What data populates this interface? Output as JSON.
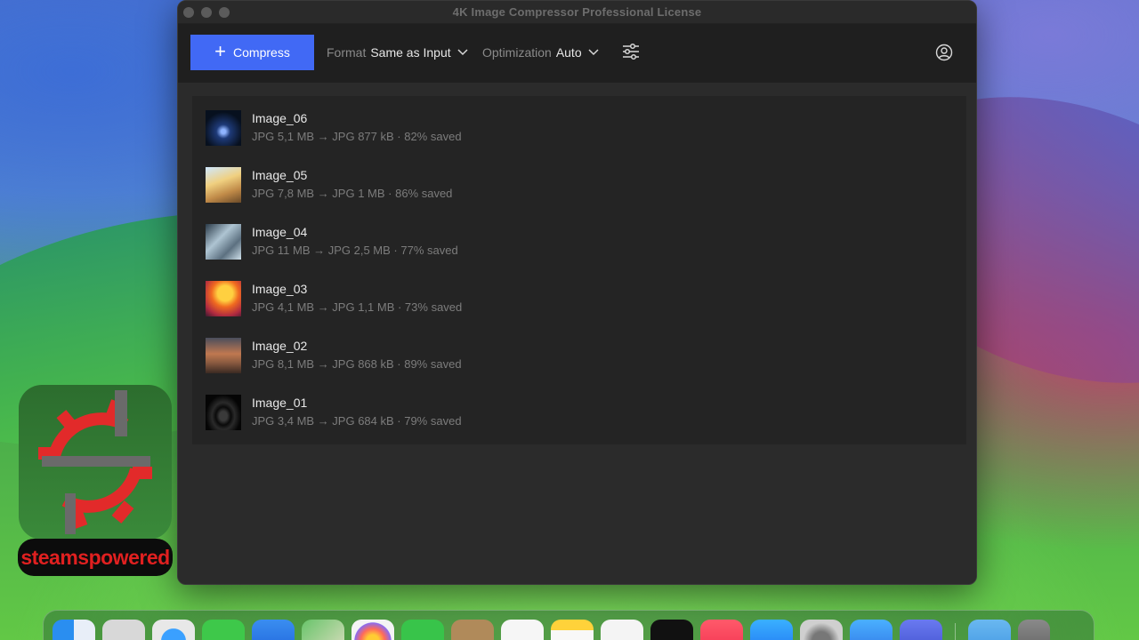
{
  "window": {
    "title": "4K Image Compressor Professional License"
  },
  "toolbar": {
    "compress_label": "Compress",
    "format_label": "Format",
    "format_value": "Same as Input",
    "optimization_label": "Optimization",
    "optimization_value": "Auto"
  },
  "files": [
    {
      "name": "Image_06",
      "info": "JPG 5,1 MB → JPG 877 kB · 82% saved"
    },
    {
      "name": "Image_05",
      "info": "JPG 7,8 MB → JPG 1 MB · 86% saved"
    },
    {
      "name": "Image_04",
      "info": "JPG 11 MB → JPG 2,5 MB · 77% saved"
    },
    {
      "name": "Image_03",
      "info": "JPG 4,1 MB → JPG 1,1 MB · 73% saved"
    },
    {
      "name": "Image_02",
      "info": "JPG 8,1 MB → JPG 868 kB · 89% saved"
    },
    {
      "name": "Image_01",
      "info": "JPG 3,4 MB → JPG 684 kB · 79% saved"
    }
  ],
  "watermark": {
    "text": "steamspowered"
  },
  "colors": {
    "accent": "#4169f5",
    "window_bg": "#2b2b2b",
    "toolbar_bg": "#1f1f1f",
    "list_bg": "#242424"
  },
  "dock": {
    "icons": [
      "finder-icon",
      "launchpad-icon",
      "safari-icon",
      "messages-icon",
      "mail-icon",
      "maps-icon",
      "photos-icon",
      "facetime-icon",
      "contacts-icon",
      "reminders-icon",
      "notes-icon",
      "freeform-icon",
      "appletv-icon",
      "music-icon",
      "appstore-icon",
      "system-settings-icon",
      "4k-app-icon",
      "other-app-icon",
      "downloads-folder-icon",
      "trash-icon"
    ]
  }
}
